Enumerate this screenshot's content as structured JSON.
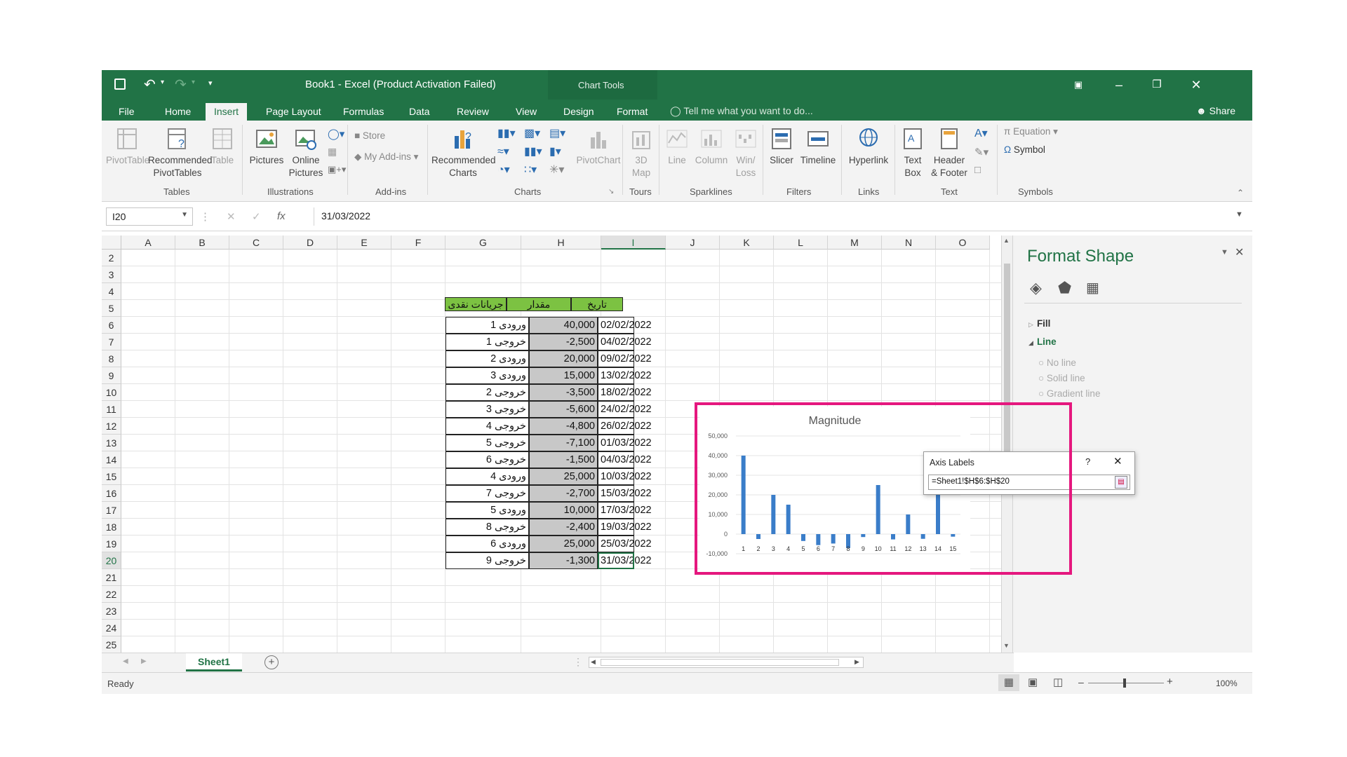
{
  "window": {
    "title": "Book1 - Excel (Product Activation Failed)",
    "contextual_tab": "Chart Tools"
  },
  "tabs": [
    "File",
    "Home",
    "Insert",
    "Page Layout",
    "Formulas",
    "Data",
    "Review",
    "View",
    "Design",
    "Format"
  ],
  "active_tab": "Insert",
  "tell_me": "Tell me what you want to do...",
  "share": "Share",
  "ribbon": {
    "tables": {
      "label": "Tables",
      "pivottable": "PivotTable",
      "rec_pivot_1": "Recommended",
      "rec_pivot_2": "PivotTables",
      "table": "Table"
    },
    "illustrations": {
      "label": "Illustrations",
      "pictures": "Pictures",
      "online_1": "Online",
      "online_2": "Pictures"
    },
    "addins": {
      "label": "Add-ins",
      "store": "Store",
      "my_addins": "My Add-ins"
    },
    "charts": {
      "label": "Charts",
      "rec_1": "Recommended",
      "rec_2": "Charts",
      "pivotchart": "PivotChart"
    },
    "tours": {
      "label": "Tours",
      "map_1": "3D",
      "map_2": "Map"
    },
    "sparklines": {
      "label": "Sparklines",
      "line": "Line",
      "column": "Column",
      "winloss_1": "Win/",
      "winloss_2": "Loss"
    },
    "filters": {
      "label": "Filters",
      "slicer": "Slicer",
      "timeline": "Timeline"
    },
    "links": {
      "label": "Links",
      "hyperlink": "Hyperlink"
    },
    "text": {
      "label": "Text",
      "textbox_1": "Text",
      "textbox_2": "Box",
      "header_1": "Header",
      "header_2": "& Footer"
    },
    "symbols": {
      "label": "Symbols",
      "equation": "Equation",
      "symbol": "Symbol"
    }
  },
  "formula_bar": {
    "name_box": "I20",
    "value": "31/03/2022",
    "fx": "fx"
  },
  "columns": [
    "A",
    "B",
    "C",
    "D",
    "E",
    "F",
    "G",
    "H",
    "I",
    "J",
    "K",
    "L",
    "M",
    "N",
    "O"
  ],
  "rows": [
    "2",
    "3",
    "4",
    "5",
    "6",
    "7",
    "8",
    "9",
    "10",
    "11",
    "12",
    "13",
    "14",
    "15",
    "16",
    "17",
    "18",
    "19",
    "20",
    "21",
    "22",
    "23",
    "24",
    "25"
  ],
  "selected_cell": {
    "column": "I",
    "row": "20"
  },
  "table": {
    "headers": [
      "جریانات نقدی",
      "مقدار",
      "تاریخ"
    ],
    "rows": [
      [
        "ورودی 1",
        "40,000",
        "02/02/2022"
      ],
      [
        "خروجی 1",
        "-2,500",
        "04/02/2022"
      ],
      [
        "ورودی 2",
        "20,000",
        "09/02/2022"
      ],
      [
        "ورودی 3",
        "15,000",
        "13/02/2022"
      ],
      [
        "خروجی 2",
        "-3,500",
        "18/02/2022"
      ],
      [
        "خروجی 3",
        "-5,600",
        "24/02/2022"
      ],
      [
        "خروجی 4",
        "-4,800",
        "26/02/2022"
      ],
      [
        "خروجی 5",
        "-7,100",
        "01/03/2022"
      ],
      [
        "خروجی 6",
        "-1,500",
        "04/03/2022"
      ],
      [
        "ورودی 4",
        "25,000",
        "10/03/2022"
      ],
      [
        "خروجی 7",
        "-2,700",
        "15/03/2022"
      ],
      [
        "ورودی 5",
        "10,000",
        "17/03/2022"
      ],
      [
        "خروجی 8",
        "-2,400",
        "19/03/2022"
      ],
      [
        "ورودی 6",
        "25,000",
        "25/03/2022"
      ],
      [
        "خروجی 9",
        "-1,300",
        "31/03/2022"
      ]
    ]
  },
  "sheet_tab": "Sheet1",
  "status": "Ready",
  "zoom": "100%",
  "format_pane": {
    "title": "Format Shape",
    "fill": "Fill",
    "line": "Line",
    "no_line": "No line",
    "solid_line": "Solid line",
    "gradient_line": "Gradient line"
  },
  "dialog": {
    "title": "Axis Labels",
    "help": "?",
    "value": "=Sheet1!$H$6:$H$20"
  },
  "chart_data": {
    "type": "bar",
    "title": "Magnitude",
    "categories": [
      "1",
      "2",
      "3",
      "4",
      "5",
      "6",
      "7",
      "8",
      "9",
      "10",
      "11",
      "12",
      "13",
      "14",
      "15"
    ],
    "values": [
      40000,
      -2500,
      20000,
      15000,
      -3500,
      -5600,
      -4800,
      -7100,
      -1500,
      25000,
      -2700,
      10000,
      -2400,
      25000,
      -1300
    ],
    "y_ticks": [
      "50,000",
      "40,000",
      "30,000",
      "20,000",
      "10,000",
      "0",
      "-10,000"
    ],
    "ylim": [
      -10000,
      50000
    ],
    "bar_color": "#3a7dc9",
    "grid": true
  },
  "colors": {
    "excel_green": "#217346",
    "header_fill": "#7cc242",
    "highlight": "#e5177e"
  }
}
